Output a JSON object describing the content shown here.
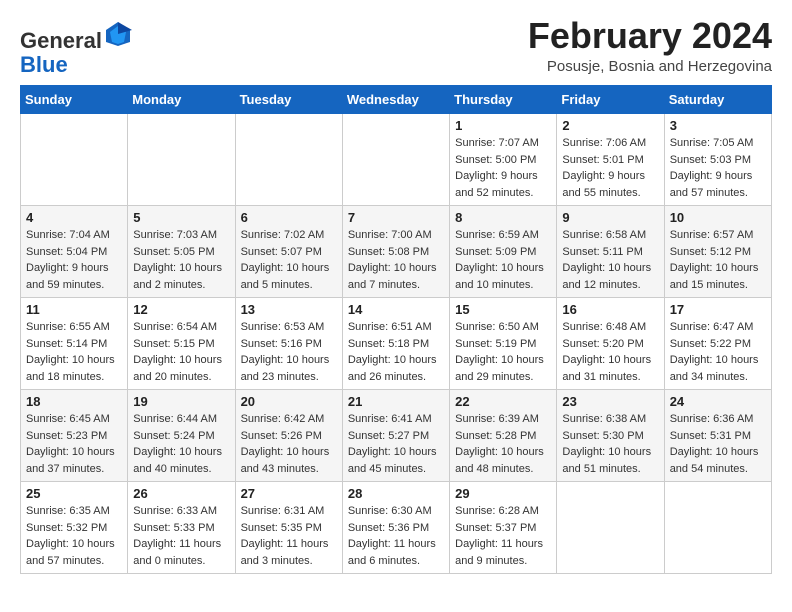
{
  "header": {
    "logo_general": "General",
    "logo_blue": "Blue",
    "month_title": "February 2024",
    "location": "Posusje, Bosnia and Herzegovina"
  },
  "weekdays": [
    "Sunday",
    "Monday",
    "Tuesday",
    "Wednesday",
    "Thursday",
    "Friday",
    "Saturday"
  ],
  "rows": [
    {
      "shade": "white",
      "cells": [
        {
          "day": "",
          "info": ""
        },
        {
          "day": "",
          "info": ""
        },
        {
          "day": "",
          "info": ""
        },
        {
          "day": "",
          "info": ""
        },
        {
          "day": "1",
          "info": "Sunrise: 7:07 AM\nSunset: 5:00 PM\nDaylight: 9 hours\nand 52 minutes."
        },
        {
          "day": "2",
          "info": "Sunrise: 7:06 AM\nSunset: 5:01 PM\nDaylight: 9 hours\nand 55 minutes."
        },
        {
          "day": "3",
          "info": "Sunrise: 7:05 AM\nSunset: 5:03 PM\nDaylight: 9 hours\nand 57 minutes."
        }
      ]
    },
    {
      "shade": "shaded",
      "cells": [
        {
          "day": "4",
          "info": "Sunrise: 7:04 AM\nSunset: 5:04 PM\nDaylight: 9 hours\nand 59 minutes."
        },
        {
          "day": "5",
          "info": "Sunrise: 7:03 AM\nSunset: 5:05 PM\nDaylight: 10 hours\nand 2 minutes."
        },
        {
          "day": "6",
          "info": "Sunrise: 7:02 AM\nSunset: 5:07 PM\nDaylight: 10 hours\nand 5 minutes."
        },
        {
          "day": "7",
          "info": "Sunrise: 7:00 AM\nSunset: 5:08 PM\nDaylight: 10 hours\nand 7 minutes."
        },
        {
          "day": "8",
          "info": "Sunrise: 6:59 AM\nSunset: 5:09 PM\nDaylight: 10 hours\nand 10 minutes."
        },
        {
          "day": "9",
          "info": "Sunrise: 6:58 AM\nSunset: 5:11 PM\nDaylight: 10 hours\nand 12 minutes."
        },
        {
          "day": "10",
          "info": "Sunrise: 6:57 AM\nSunset: 5:12 PM\nDaylight: 10 hours\nand 15 minutes."
        }
      ]
    },
    {
      "shade": "white",
      "cells": [
        {
          "day": "11",
          "info": "Sunrise: 6:55 AM\nSunset: 5:14 PM\nDaylight: 10 hours\nand 18 minutes."
        },
        {
          "day": "12",
          "info": "Sunrise: 6:54 AM\nSunset: 5:15 PM\nDaylight: 10 hours\nand 20 minutes."
        },
        {
          "day": "13",
          "info": "Sunrise: 6:53 AM\nSunset: 5:16 PM\nDaylight: 10 hours\nand 23 minutes."
        },
        {
          "day": "14",
          "info": "Sunrise: 6:51 AM\nSunset: 5:18 PM\nDaylight: 10 hours\nand 26 minutes."
        },
        {
          "day": "15",
          "info": "Sunrise: 6:50 AM\nSunset: 5:19 PM\nDaylight: 10 hours\nand 29 minutes."
        },
        {
          "day": "16",
          "info": "Sunrise: 6:48 AM\nSunset: 5:20 PM\nDaylight: 10 hours\nand 31 minutes."
        },
        {
          "day": "17",
          "info": "Sunrise: 6:47 AM\nSunset: 5:22 PM\nDaylight: 10 hours\nand 34 minutes."
        }
      ]
    },
    {
      "shade": "shaded",
      "cells": [
        {
          "day": "18",
          "info": "Sunrise: 6:45 AM\nSunset: 5:23 PM\nDaylight: 10 hours\nand 37 minutes."
        },
        {
          "day": "19",
          "info": "Sunrise: 6:44 AM\nSunset: 5:24 PM\nDaylight: 10 hours\nand 40 minutes."
        },
        {
          "day": "20",
          "info": "Sunrise: 6:42 AM\nSunset: 5:26 PM\nDaylight: 10 hours\nand 43 minutes."
        },
        {
          "day": "21",
          "info": "Sunrise: 6:41 AM\nSunset: 5:27 PM\nDaylight: 10 hours\nand 45 minutes."
        },
        {
          "day": "22",
          "info": "Sunrise: 6:39 AM\nSunset: 5:28 PM\nDaylight: 10 hours\nand 48 minutes."
        },
        {
          "day": "23",
          "info": "Sunrise: 6:38 AM\nSunset: 5:30 PM\nDaylight: 10 hours\nand 51 minutes."
        },
        {
          "day": "24",
          "info": "Sunrise: 6:36 AM\nSunset: 5:31 PM\nDaylight: 10 hours\nand 54 minutes."
        }
      ]
    },
    {
      "shade": "white",
      "cells": [
        {
          "day": "25",
          "info": "Sunrise: 6:35 AM\nSunset: 5:32 PM\nDaylight: 10 hours\nand 57 minutes."
        },
        {
          "day": "26",
          "info": "Sunrise: 6:33 AM\nSunset: 5:33 PM\nDaylight: 11 hours\nand 0 minutes."
        },
        {
          "day": "27",
          "info": "Sunrise: 6:31 AM\nSunset: 5:35 PM\nDaylight: 11 hours\nand 3 minutes."
        },
        {
          "day": "28",
          "info": "Sunrise: 6:30 AM\nSunset: 5:36 PM\nDaylight: 11 hours\nand 6 minutes."
        },
        {
          "day": "29",
          "info": "Sunrise: 6:28 AM\nSunset: 5:37 PM\nDaylight: 11 hours\nand 9 minutes."
        },
        {
          "day": "",
          "info": ""
        },
        {
          "day": "",
          "info": ""
        }
      ]
    }
  ]
}
